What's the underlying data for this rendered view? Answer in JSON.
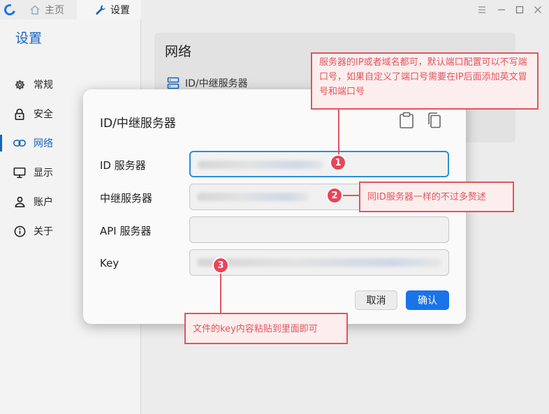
{
  "titlebar": {
    "tabs": [
      {
        "label": "主页",
        "icon": "home-icon"
      },
      {
        "label": "设置",
        "icon": "wrench-icon"
      }
    ],
    "controls": [
      "menu-icon",
      "minimize-icon",
      "maximize-icon",
      "close-icon"
    ]
  },
  "sidebar": {
    "title": "设置",
    "items": [
      {
        "label": "常规",
        "icon": "gear-icon"
      },
      {
        "label": "安全",
        "icon": "lock-icon"
      },
      {
        "label": "网络",
        "icon": "link-icon",
        "active": true
      },
      {
        "label": "显示",
        "icon": "monitor-icon"
      },
      {
        "label": "账户",
        "icon": "user-icon"
      },
      {
        "label": "关于",
        "icon": "info-icon"
      }
    ]
  },
  "main": {
    "card_title": "网络",
    "card_row_label": "ID/中继服务器"
  },
  "modal": {
    "title": "ID/中继服务器",
    "fields": [
      {
        "label": "ID 服务器",
        "value": "",
        "blurred": true
      },
      {
        "label": "中继服务器",
        "value": "",
        "blurred": true
      },
      {
        "label": "API 服务器",
        "value": ""
      },
      {
        "label": "Key",
        "value": "",
        "blurred": true
      }
    ],
    "cancel_label": "取消",
    "confirm_label": "确认"
  },
  "annotations": {
    "note1": "服务器的IP或者域名都可，默认端口配置可以不写端口号，如果自定义了端口号需要在IP后面添加英文冒号和端口号",
    "note2": "同ID服务器一样的不过多赘述",
    "note3": "文件的key内容粘贴到里面即可",
    "markers": [
      "1",
      "2",
      "3"
    ],
    "color": "#e0545f"
  },
  "colors": {
    "accent": "#1565c0",
    "button_primary": "#1a73e8"
  }
}
